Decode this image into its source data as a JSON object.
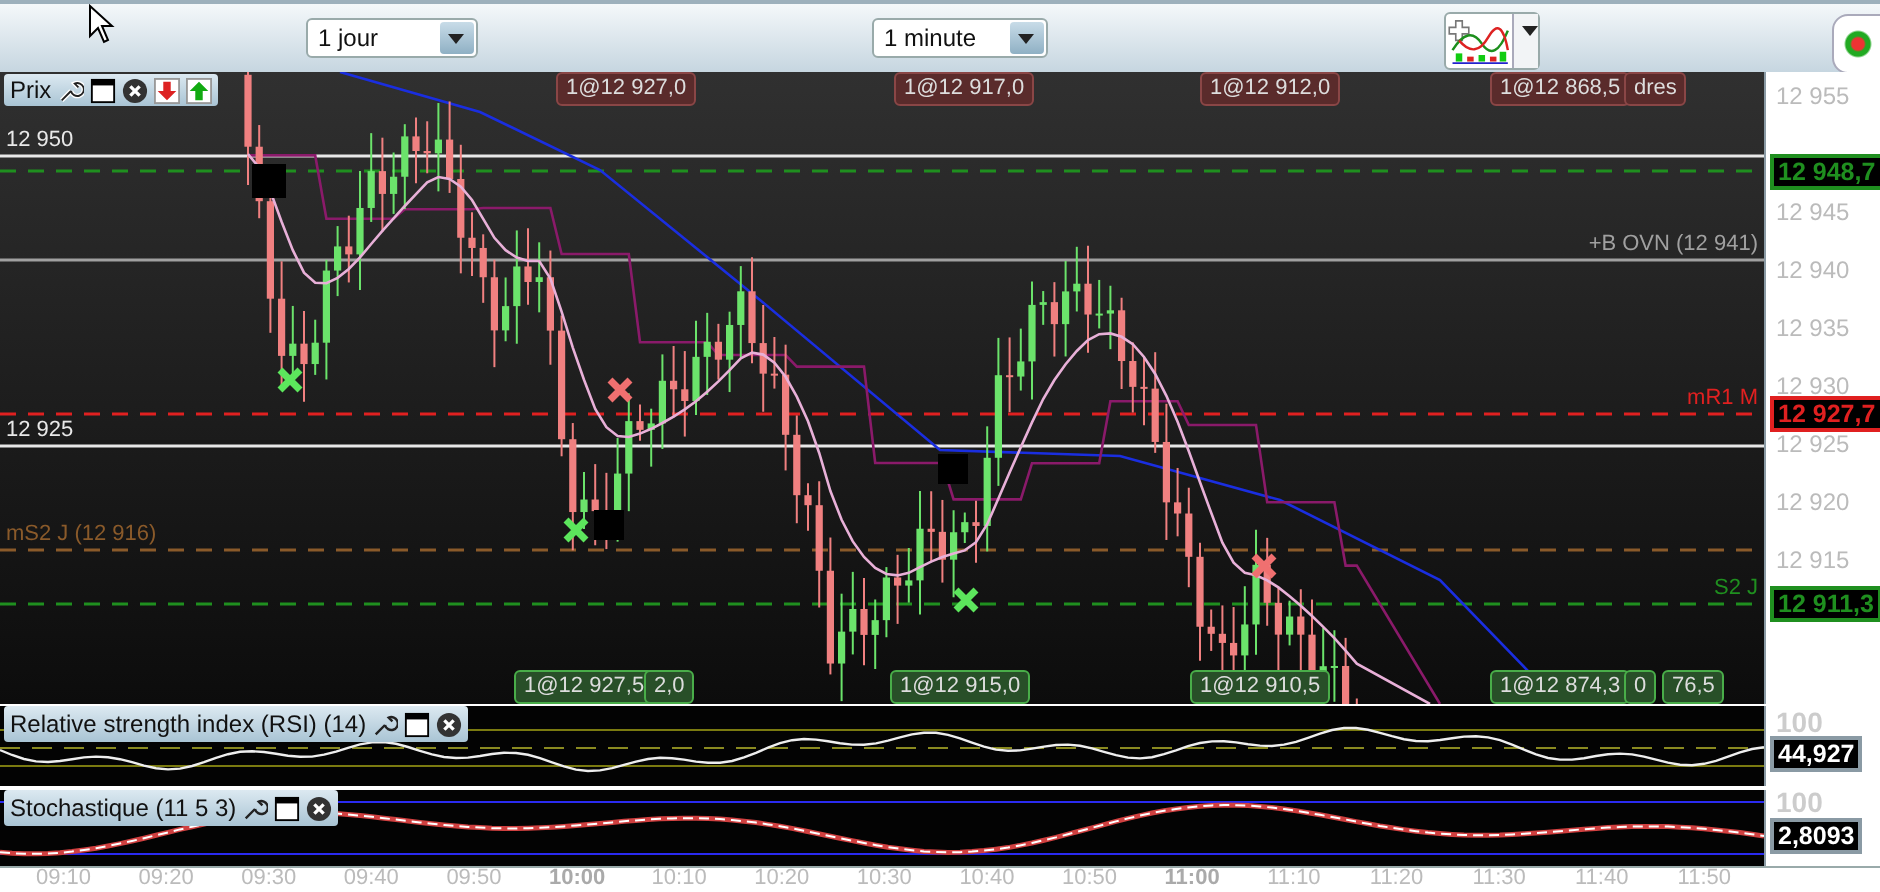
{
  "toolbar": {
    "period_select": "1 jour",
    "interval_select": "1 minute"
  },
  "price_panel": {
    "title": "Prix",
    "top_tags": [
      "1@12 927,0",
      "1@12 917,0",
      "1@12 912,0",
      "1@12 868,5",
      "dres"
    ],
    "bottom_tags": [
      "1@12 927,5",
      "2,0",
      "1@12 915,0",
      "1@12 910,5",
      "1@12 874,3",
      "0",
      "76,5"
    ],
    "levels": [
      {
        "label": "12 950",
        "color": "#e8e8e8",
        "kind": "solid"
      },
      {
        "badge": "12 948,7",
        "color": "#1f8f1f",
        "kind": "dashed"
      },
      {
        "label": "+B OVN (12 941)",
        "color": "#a0a0a0",
        "kind": "solid"
      },
      {
        "label": "mR1 M",
        "badge": "12 927,7",
        "color": "#e02020",
        "kind": "dashed"
      },
      {
        "label": "12 925",
        "color": "#e8e8e8",
        "kind": "solid"
      },
      {
        "label": "mS2 J (12 916)",
        "color": "#8a5a2a",
        "kind": "dashed"
      },
      {
        "label": "S2 J",
        "badge": "12 911,3",
        "color": "#1f8f1f",
        "kind": "dashed"
      }
    ],
    "axis_ticks": [
      "12 955",
      "12 945",
      "12 940",
      "12 935",
      "12 930",
      "12 925",
      "12 920",
      "12 915"
    ]
  },
  "rsi_panel": {
    "title": "Relative strength index (RSI) (14)",
    "axis_tick": "100",
    "badge": "44,927"
  },
  "stochastic_panel": {
    "title": "Stochastique (11 5 3)",
    "axis_tick": "100",
    "badge": "2,8093"
  },
  "time_axis": [
    {
      "label": "09:10",
      "major": false
    },
    {
      "label": "09:20",
      "major": false
    },
    {
      "label": "09:30",
      "major": false
    },
    {
      "label": "09:40",
      "major": false
    },
    {
      "label": "09:50",
      "major": false
    },
    {
      "label": "10:00",
      "major": true
    },
    {
      "label": "10:10",
      "major": false
    },
    {
      "label": "10:20",
      "major": false
    },
    {
      "label": "10:30",
      "major": false
    },
    {
      "label": "10:40",
      "major": false
    },
    {
      "label": "10:50",
      "major": false
    },
    {
      "label": "11:00",
      "major": true
    },
    {
      "label": "11:10",
      "major": false
    },
    {
      "label": "11:20",
      "major": false
    },
    {
      "label": "11:30",
      "major": false
    },
    {
      "label": "11:40",
      "major": false
    },
    {
      "label": "11:50",
      "major": false
    }
  ]
}
